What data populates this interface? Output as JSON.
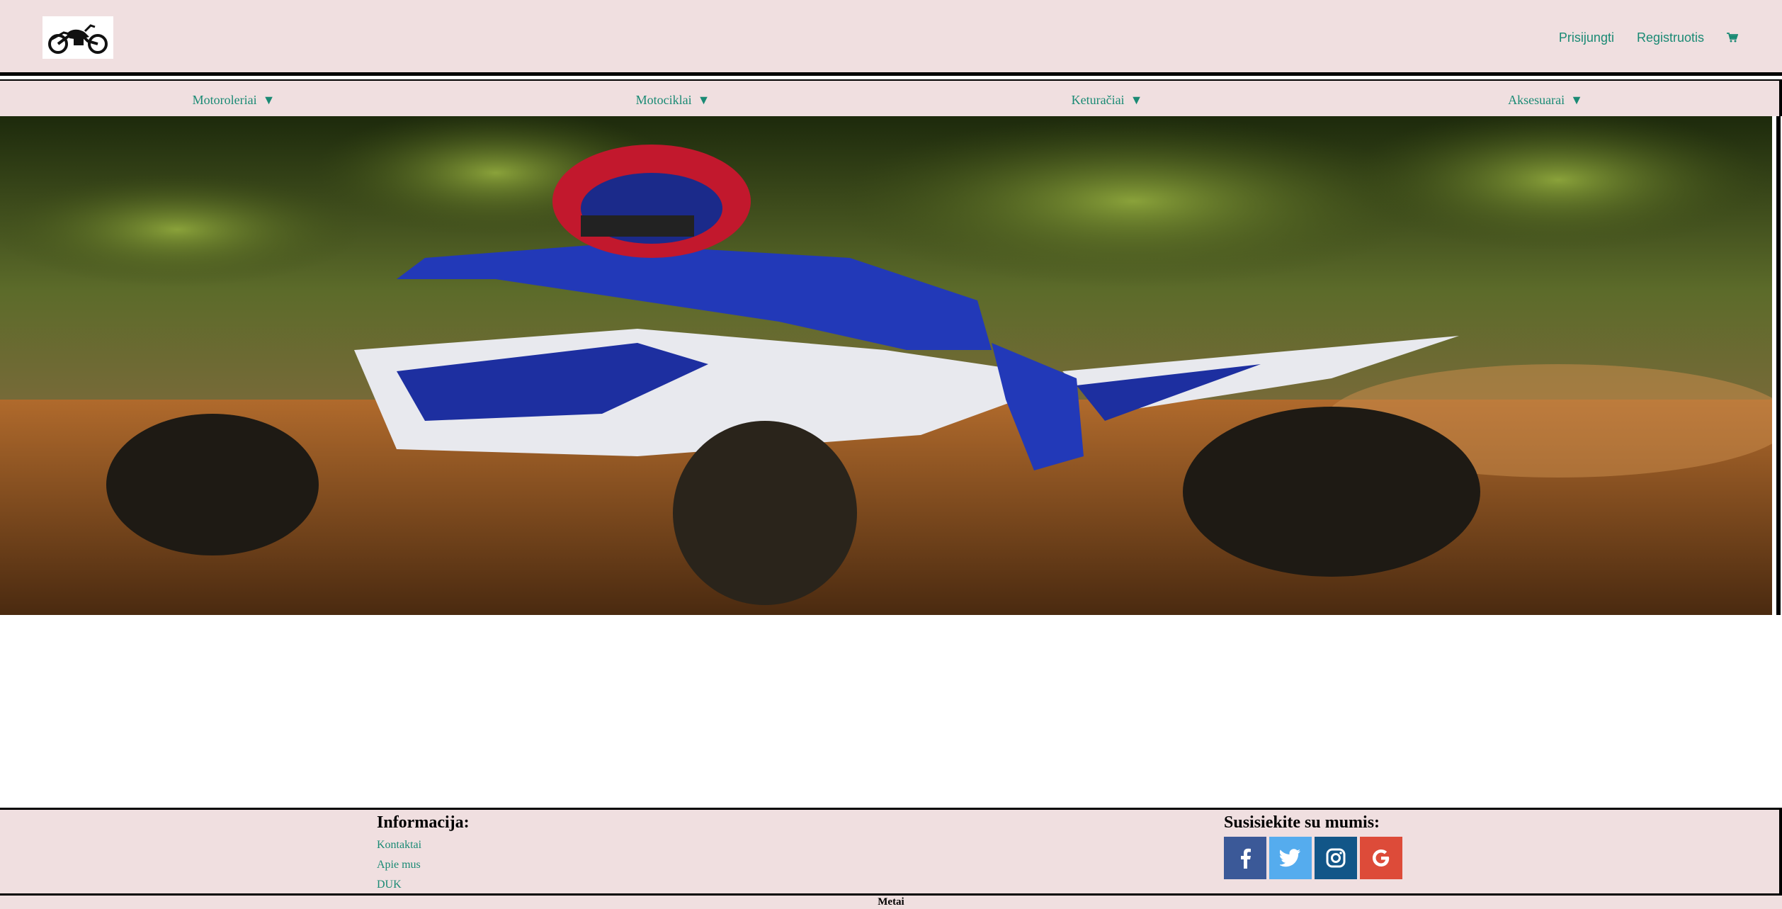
{
  "header": {
    "logo_alt": "motorcycle-logo",
    "links": {
      "login": "Prisijungti",
      "register": "Registruotis"
    },
    "cart_icon": "shopping-cart-icon"
  },
  "nav": {
    "items": [
      {
        "label": "Motoroleriai",
        "caret": "▼"
      },
      {
        "label": "Motociklai",
        "caret": "▼"
      },
      {
        "label": "Keturačiai",
        "caret": "▼"
      },
      {
        "label": "Aksesuarai",
        "caret": "▼"
      }
    ]
  },
  "hero": {
    "image": "atv-rider-photo"
  },
  "footer": {
    "info": {
      "heading": "Informacija:",
      "links": [
        "Kontaktai",
        "Apie mus",
        "DUK"
      ]
    },
    "contact": {
      "heading": "Susisiekite su mumis:",
      "social": [
        {
          "name": "facebook-icon",
          "color": "#3b5998"
        },
        {
          "name": "twitter-icon",
          "color": "#55acee"
        },
        {
          "name": "instagram-icon",
          "color": "#125688"
        },
        {
          "name": "google-icon",
          "color": "#dd4b39"
        }
      ]
    },
    "bottom_text": "Metai"
  }
}
